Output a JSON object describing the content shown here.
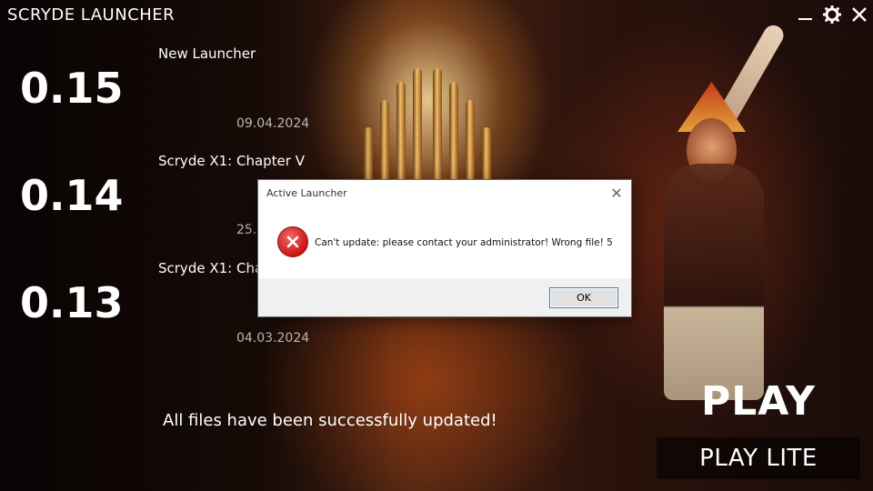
{
  "app": {
    "title": "SCRYDE LAUNCHER"
  },
  "window_controls": {
    "minimize_icon": "minimize-icon",
    "settings_icon": "gear-icon",
    "close_icon": "close-icon"
  },
  "news": [
    {
      "version": "0.15",
      "title": "New Launcher",
      "date": "09.04.2024"
    },
    {
      "version": "0.14",
      "title": "Scryde X1: Chapter V",
      "date": "25."
    },
    {
      "version": "0.13",
      "title": "Scryde X1: Cha",
      "date": "04.03.2024"
    }
  ],
  "status": {
    "text": "All files have been successfully updated!"
  },
  "buttons": {
    "play": "PLAY",
    "play_lite": "PLAY LITE"
  },
  "dialog": {
    "title": "Active Launcher",
    "message": "Can't update: please contact your administrator! Wrong file! 5",
    "ok_label": "OK",
    "icon": "error-icon",
    "close_glyph": "✕"
  },
  "colors": {
    "error": "#c91515",
    "dialog_bg": "#f0f0f0",
    "date_text": "#bdb7b2"
  }
}
